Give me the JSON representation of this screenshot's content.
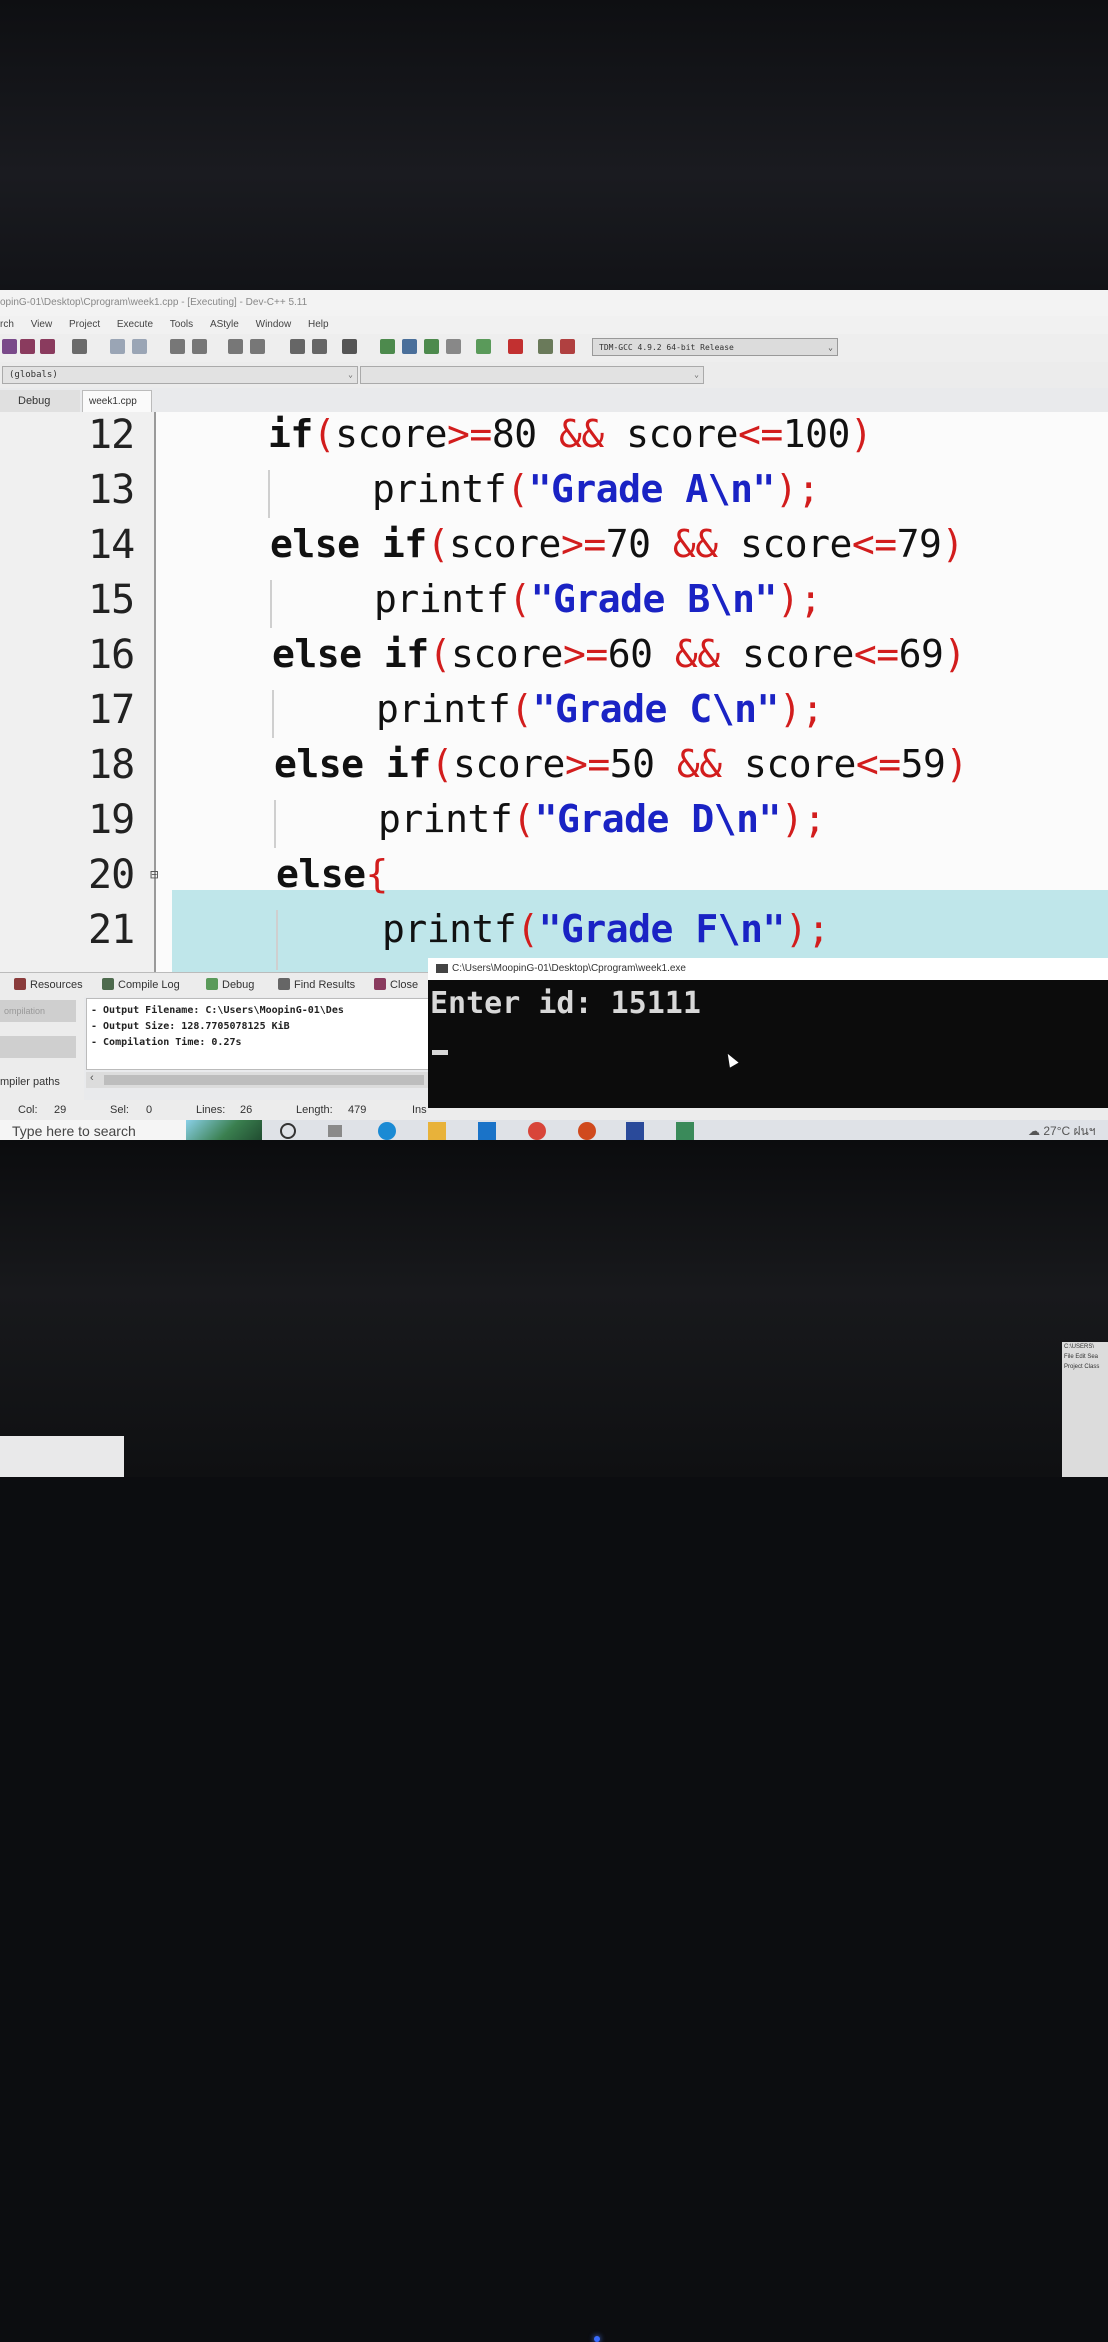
{
  "window": {
    "title": "opinG-01\\Desktop\\Cprogram\\week1.cpp  - [Executing] - Dev-C++ 5.11"
  },
  "menu": [
    "rch",
    "View",
    "Project",
    "Execute",
    "Tools",
    "AStyle",
    "Window",
    "Help"
  ],
  "toolbar": {
    "compiler": "TDM-GCC 4.9.2 64-bit Release"
  },
  "scope": {
    "value": "(globals)"
  },
  "left_panel": {
    "tab_label": "Debug"
  },
  "editor": {
    "file_tab": "week1.cpp",
    "line_numbers": [
      "12",
      "13",
      "14",
      "15",
      "16",
      "17",
      "18",
      "19",
      "20",
      "21"
    ]
  },
  "bottom_tabs": [
    "Resources",
    "Compile Log",
    "Debug",
    "Find Results",
    "Close"
  ],
  "compile_side": {
    "button1": "ompilation",
    "paths_label": "mpiler paths"
  },
  "compile_log": [
    "- Output Filename: C:\\Users\\MoopinG-01\\Des",
    "- Output Size: 128.7705078125 KiB",
    "- Compilation Time: 0.27s"
  ],
  "status": {
    "col_label": "Col:",
    "col": "29",
    "sel_label": "Sel:",
    "sel": "0",
    "lines_label": "Lines:",
    "lines": "26",
    "length_label": "Length:",
    "length": "479",
    "insert": "Ins"
  },
  "console": {
    "title": "C:\\Users\\MoopinG-01\\Desktop\\Cprogram\\week1.exe",
    "output": "Enter id: 15111"
  },
  "taskbar": {
    "search_placeholder": "Type here to search",
    "weather": "27°C ฝนฯ"
  },
  "second_monitor": {
    "title": "C:\\USERS\\",
    "menu": "File  Edit  Sea",
    "label": "Project  Class"
  },
  "colors": {
    "keyword": "#111111",
    "operator": "#d21d1d",
    "string": "#1a23c4",
    "active_line": "#bfe6ea",
    "console_bg": "#0c0c0c"
  }
}
